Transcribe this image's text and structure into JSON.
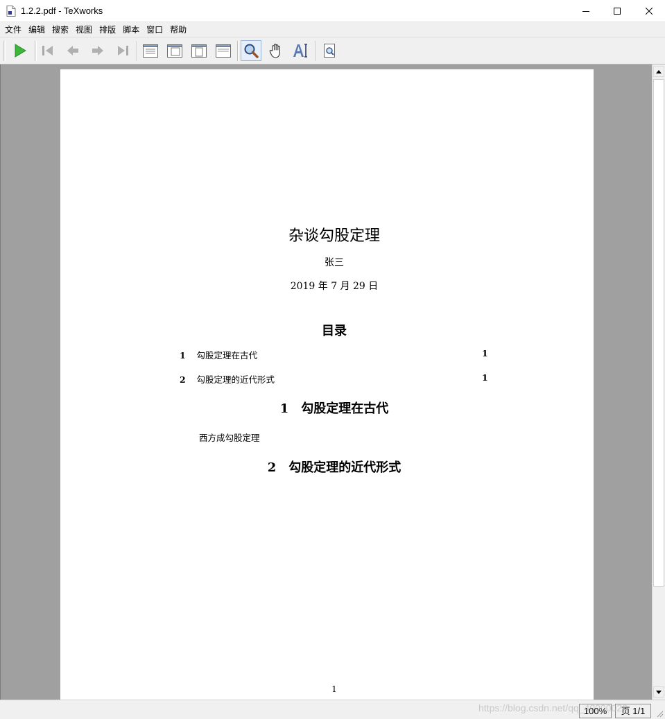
{
  "window": {
    "title": "1.2.2.pdf - TeXworks",
    "icon": "pdf-document-icon"
  },
  "menu": [
    "文件",
    "编辑",
    "搜索",
    "视图",
    "排版",
    "脚本",
    "窗口",
    "帮助"
  ],
  "toolbar": {
    "buttons": [
      {
        "name": "typeset-icon",
        "tooltip": "Typeset"
      },
      {
        "name": "first-page-icon"
      },
      {
        "name": "previous-page-icon"
      },
      {
        "name": "next-page-icon"
      },
      {
        "name": "last-page-icon"
      },
      {
        "name": "actual-size-icon"
      },
      {
        "name": "fit-width-icon"
      },
      {
        "name": "fit-window-icon"
      },
      {
        "name": "fit-content-icon"
      },
      {
        "name": "magnify-tool-icon",
        "active": true
      },
      {
        "name": "scroll-hand-tool-icon"
      },
      {
        "name": "select-text-tool-icon"
      },
      {
        "name": "find-in-pdf-icon"
      }
    ]
  },
  "document": {
    "title": "杂谈勾股定理",
    "author": "张三",
    "date": "2019 年 7 月 29 日",
    "toc_heading": "目录",
    "toc": [
      {
        "num": "1",
        "title": "勾股定理在古代",
        "page": "1"
      },
      {
        "num": "2",
        "title": "勾股定理的近代形式",
        "page": "1"
      }
    ],
    "sections": [
      {
        "num": "1",
        "title": "勾股定理在古代",
        "body": "西方成勾股定理"
      },
      {
        "num": "2",
        "title": "勾股定理的近代形式",
        "body": ""
      }
    ],
    "page_number": "1"
  },
  "status": {
    "zoom": "100%",
    "page": "页 1/1"
  },
  "watermark": "https://blog.csdn.net/qq_40000026",
  "colors": {
    "viewer_background": "#a0a0a0",
    "typeset_green": "#3cb73c",
    "toolbar_bg": "#f0f0f0"
  }
}
